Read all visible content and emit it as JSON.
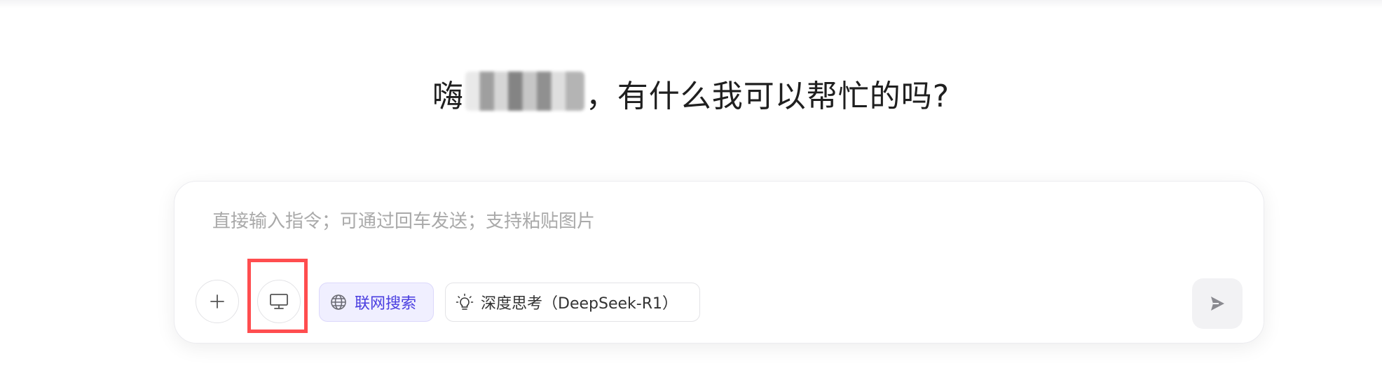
{
  "greeting": {
    "prefix": "嗨",
    "suffix": "，有什么我可以帮忙的吗?"
  },
  "composer": {
    "placeholder": "直接输入指令；可通过回车发送；支持粘贴图片",
    "value": ""
  },
  "toolbar": {
    "add_icon": "plus-icon",
    "screen_icon": "monitor-icon",
    "web_search_label": "联网搜索",
    "web_search_icon": "globe-icon",
    "deep_think_label": "深度思考（DeepSeek-R1）",
    "deep_think_icon": "lightbulb-icon",
    "send_icon": "send-icon"
  },
  "colors": {
    "accent": "#4a3ee0",
    "highlight": "#ff4d4f"
  }
}
